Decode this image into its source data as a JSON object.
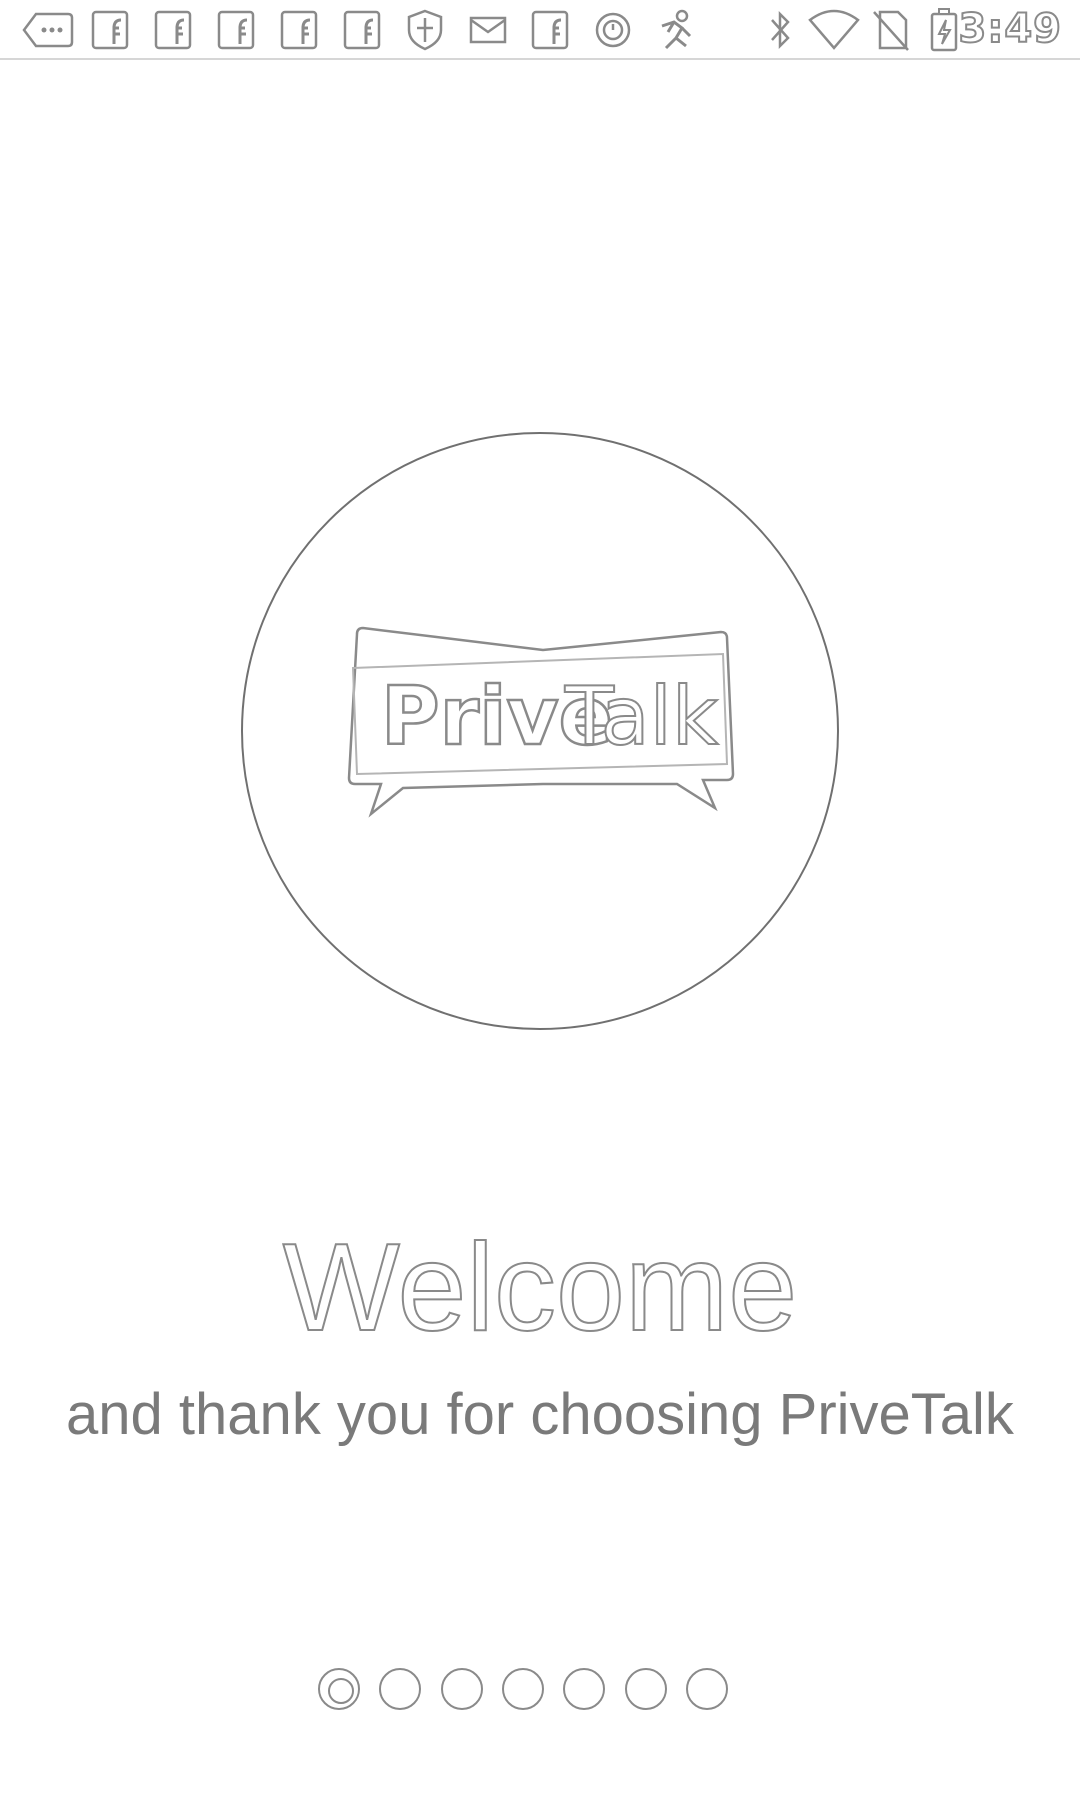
{
  "status_bar": {
    "time": "3:49",
    "notification_icons": [
      "more-notifications-icon",
      "facebook-icon",
      "facebook-icon",
      "facebook-icon",
      "facebook-icon",
      "facebook-icon",
      "shield-icon",
      "mail-icon",
      "facebook-icon",
      "clock-icon",
      "running-man-icon"
    ],
    "system_icons": [
      "bluetooth-icon",
      "wifi-icon",
      "no-sim-icon",
      "battery-charging-icon"
    ]
  },
  "logo": {
    "part1": "Prive",
    "part2": "Talk"
  },
  "welcome": {
    "title": "Welcome",
    "subtitle": "and thank you for choosing PriveTalk"
  },
  "pager": {
    "total_pages": 7,
    "current_page": 1
  }
}
